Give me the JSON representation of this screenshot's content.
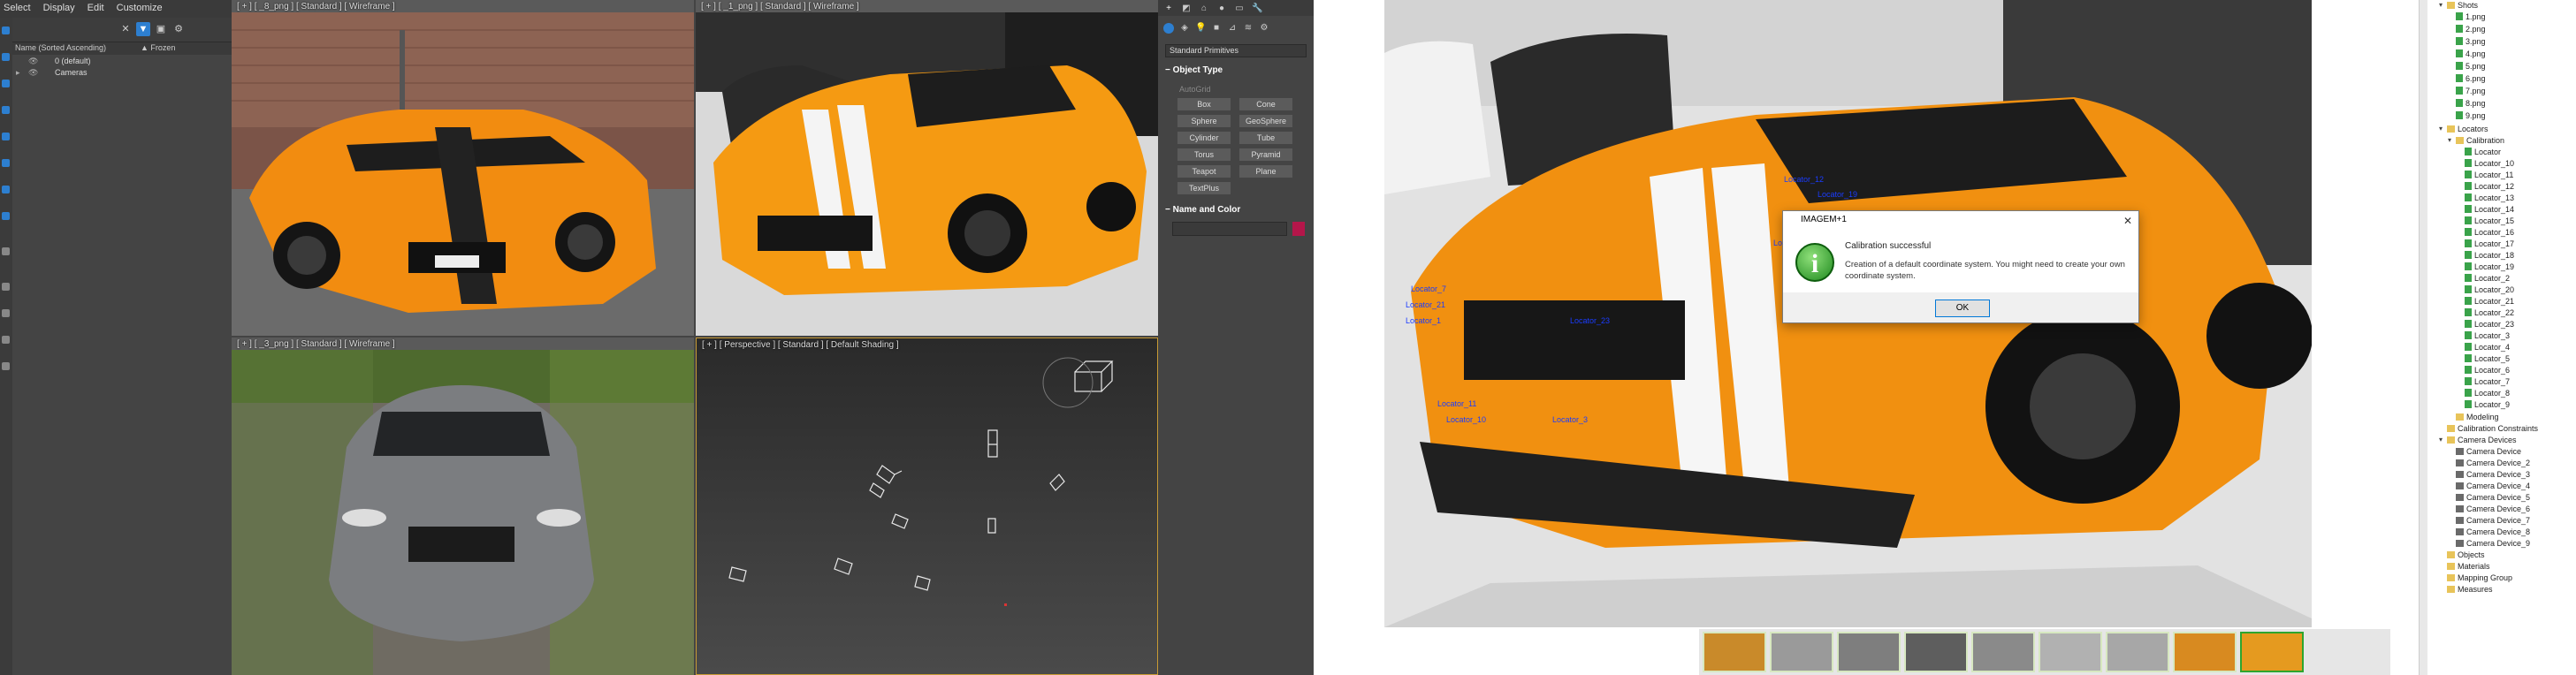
{
  "max": {
    "menu": [
      "Select",
      "Display",
      "Edit",
      "Customize"
    ],
    "scene_explorer": {
      "column_name": "Name (Sorted Ascending)",
      "column_frozen": "▲ Frozen",
      "rows": [
        "0 (default)",
        "Cameras"
      ]
    },
    "viewports": [
      {
        "label": "[ + ] [ _8_png ] [ Standard ] [ Wireframe ]"
      },
      {
        "label": "[ + ] [ _1_png ] [ Standard ] [ Wireframe ]"
      },
      {
        "label": "[ + ] [ _3_png ] [ Standard ] [ Wireframe ]"
      },
      {
        "label": "[ + ] [ Perspective ] [ Standard ] [ Default Shading ]"
      }
    ],
    "command_panel": {
      "primitive_type": "Standard Primitives",
      "object_type_title": "Object Type",
      "autogrid": "AutoGrid",
      "objects": [
        "Box",
        "Cone",
        "Sphere",
        "GeoSphere",
        "Cylinder",
        "Tube",
        "Torus",
        "Pyramid",
        "Teapot",
        "Plane",
        "TextPlus"
      ],
      "name_color_title": "Name and Color",
      "swatch_color": "#b4164a"
    }
  },
  "imagem": {
    "locators_on_image": [
      "Locator_12",
      "Locator_19",
      "Locator_7",
      "Locator_8",
      "Locator_23",
      "Locator_11",
      "Locator_10",
      "Locator_3",
      "Locator_21",
      "Locator_1"
    ],
    "dialog": {
      "title": "IMAGEM+1",
      "close": "✕",
      "heading": "Calibration successful",
      "message": "Creation of a default coordinate system. You might need to create your own coordinate system.",
      "ok": "OK"
    },
    "tree": {
      "shots_label": "Shots",
      "shots": [
        "1.png",
        "2.png",
        "3.png",
        "4.png",
        "5.png",
        "6.png",
        "7.png",
        "8.png",
        "9.png"
      ],
      "locators_label": "Locators",
      "calibration_label": "Calibration",
      "locators": [
        "Locator",
        "Locator_10",
        "Locator_11",
        "Locator_12",
        "Locator_13",
        "Locator_14",
        "Locator_15",
        "Locator_16",
        "Locator_17",
        "Locator_18",
        "Locator_19",
        "Locator_2",
        "Locator_20",
        "Locator_21",
        "Locator_22",
        "Locator_23",
        "Locator_3",
        "Locator_4",
        "Locator_5",
        "Locator_6",
        "Locator_7",
        "Locator_8",
        "Locator_9"
      ],
      "modeling_label": "Modeling",
      "calib_constraints_label": "Calibration Constraints",
      "camera_devices_label": "Camera Devices",
      "cameras": [
        "Camera Device",
        "Camera Device_2",
        "Camera Device_3",
        "Camera Device_4",
        "Camera Device_5",
        "Camera Device_6",
        "Camera Device_7",
        "Camera Device_8",
        "Camera Device_9"
      ],
      "other": [
        "Objects",
        "Materials",
        "Mapping Group",
        "Measures"
      ]
    }
  }
}
